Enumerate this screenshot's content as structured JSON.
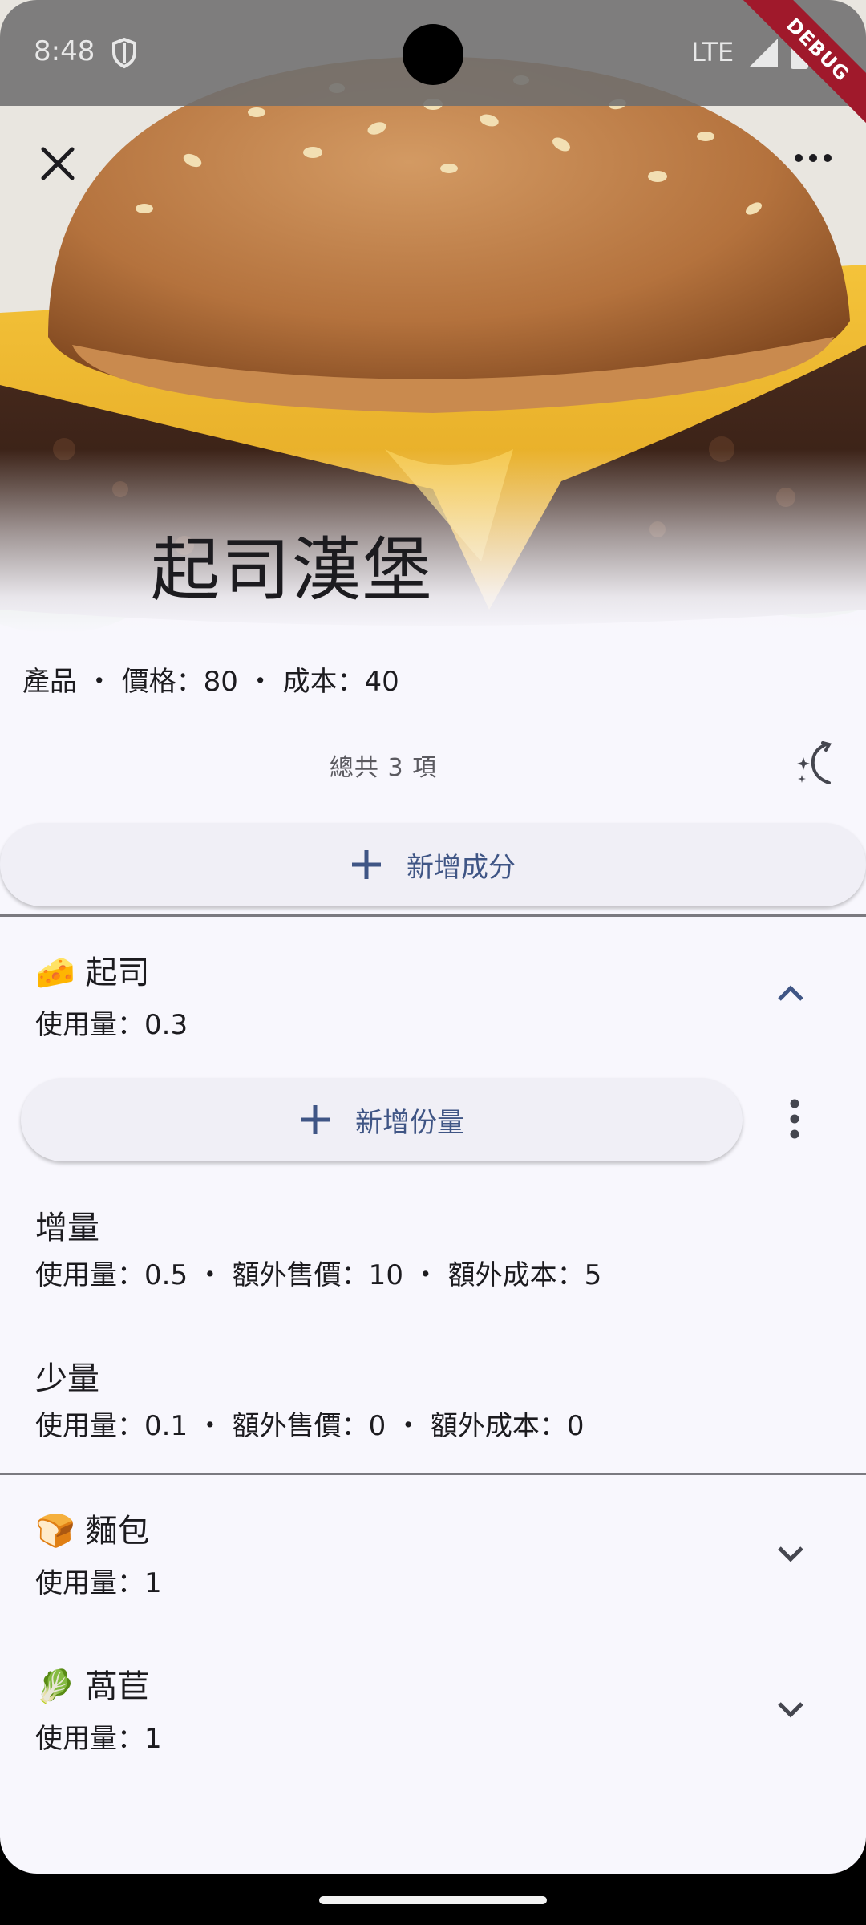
{
  "status_bar": {
    "time": "8:48",
    "network": "LTE",
    "debug_label": "DEBUG"
  },
  "product": {
    "name": "起司漢堡",
    "info_line": "產品 ・ 價格：80 ・ 成本：40",
    "total_items": "總共 3 項"
  },
  "actions": {
    "add_ingredient_label": "新增成分",
    "add_portion_label": "新增份量"
  },
  "ingredients": [
    {
      "emoji": "🧀",
      "name": "起司",
      "usage": "使用量：0.3",
      "expanded": true,
      "portions": [
        {
          "name": "增量",
          "detail": "使用量：0.5 ・ 額外售價：10 ・ 額外成本：5"
        },
        {
          "name": "少量",
          "detail": "使用量：0.1 ・ 額外售價：0 ・ 額外成本：0"
        }
      ]
    },
    {
      "emoji": "🍞",
      "name": "麵包",
      "usage": "使用量：1",
      "expanded": false
    },
    {
      "emoji": "🥬",
      "name": "萵苣",
      "usage": "使用量：1",
      "expanded": false
    }
  ],
  "icons": {
    "close": "close-icon",
    "more": "more-horiz-icon",
    "magic": "auto-fix-icon",
    "add": "add-icon",
    "expand_less": "chevron-up-icon",
    "expand_more": "chevron-down-icon",
    "more_vert": "more-vert-icon"
  },
  "colors": {
    "background": "#f8f7fd",
    "accent": "#3f5585",
    "button_bg": "#f0eff6",
    "text": "#1c1b1f"
  }
}
